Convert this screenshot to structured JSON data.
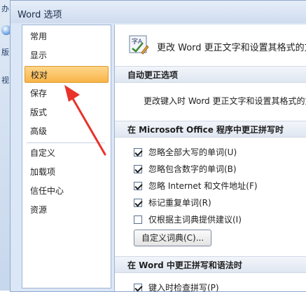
{
  "background_app": {
    "fragments": [
      "办",
      "版",
      "视"
    ]
  },
  "dialog": {
    "title": "Word 选项"
  },
  "nav": {
    "items": [
      {
        "label": "常用"
      },
      {
        "label": "显示"
      },
      {
        "label": "校对",
        "selected": true
      },
      {
        "label": "保存"
      },
      {
        "label": "版式"
      },
      {
        "label": "高级"
      },
      {
        "label": "自定义"
      },
      {
        "label": "加载项"
      },
      {
        "label": "信任中心"
      },
      {
        "label": "资源"
      }
    ]
  },
  "panel": {
    "header_text": "更改 Word 更正文字和设置其格式的方",
    "autocorrect": {
      "section_title": "自动更正选项",
      "description": "更改键入时 Word 更正文字和设置其格式的方"
    },
    "office_spelling": {
      "section_title": "在 Microsoft Office 程序中更正拼写时",
      "options": [
        {
          "label": "忽略全部大写的单词(U)",
          "checked": true
        },
        {
          "label": "忽略包含数字的单词(B)",
          "checked": true
        },
        {
          "label": "忽略 Internet 和文件地址(F)",
          "checked": true
        },
        {
          "label": "标记重复单词(R)",
          "checked": true
        },
        {
          "label": "仅根据主词典提供建议(I)",
          "checked": false
        }
      ],
      "custom_dict_button": "自定义词典(C)..."
    },
    "word_spelling": {
      "section_title": "在 Word 中更正拼写和语法时",
      "options": [
        {
          "label": "键入时检查拼写(P)",
          "checked": true
        }
      ]
    }
  },
  "colors": {
    "selected_nav": "#f8b448",
    "annotation_arrow": "#e8322a"
  }
}
